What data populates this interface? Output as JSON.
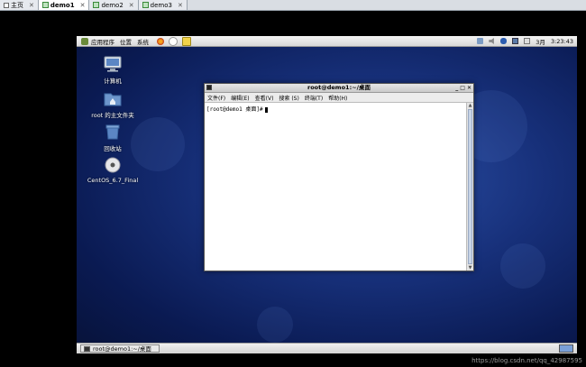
{
  "host_tabs": [
    {
      "label": "主页",
      "icon": "home-icon",
      "active": false
    },
    {
      "label": "demo1",
      "icon": "vm-icon",
      "active": true
    },
    {
      "label": "demo2",
      "icon": "vm-icon",
      "active": false
    },
    {
      "label": "demo3",
      "icon": "vm-icon",
      "active": false
    }
  ],
  "panel": {
    "menus": [
      "应用程序",
      "位置",
      "系统"
    ],
    "date": "3月",
    "time": "3:23:43"
  },
  "desktop_icons": [
    {
      "label": "计算机",
      "icon": "computer-icon"
    },
    {
      "label": "root 的主文件夹",
      "icon": "home-folder-icon"
    },
    {
      "label": "回收站",
      "icon": "trash-icon"
    },
    {
      "label": "CentOS_6.7_Final",
      "icon": "disc-icon"
    }
  ],
  "terminal": {
    "title": "root@demo1:~/桌面",
    "menu": [
      "文件(F)",
      "编辑(E)",
      "查看(V)",
      "搜索 (S)",
      "终端(T)",
      "帮助(H)"
    ],
    "prompt": "[root@demo1 桌面]#"
  },
  "taskbar": {
    "window_label": "root@demo1:~/桌面"
  },
  "watermark": "https://blog.csdn.net/qq_42987595",
  "colors": {
    "desktop": "#17307a",
    "panel": "#e4e4e4",
    "accent": "#2b4fa6"
  }
}
